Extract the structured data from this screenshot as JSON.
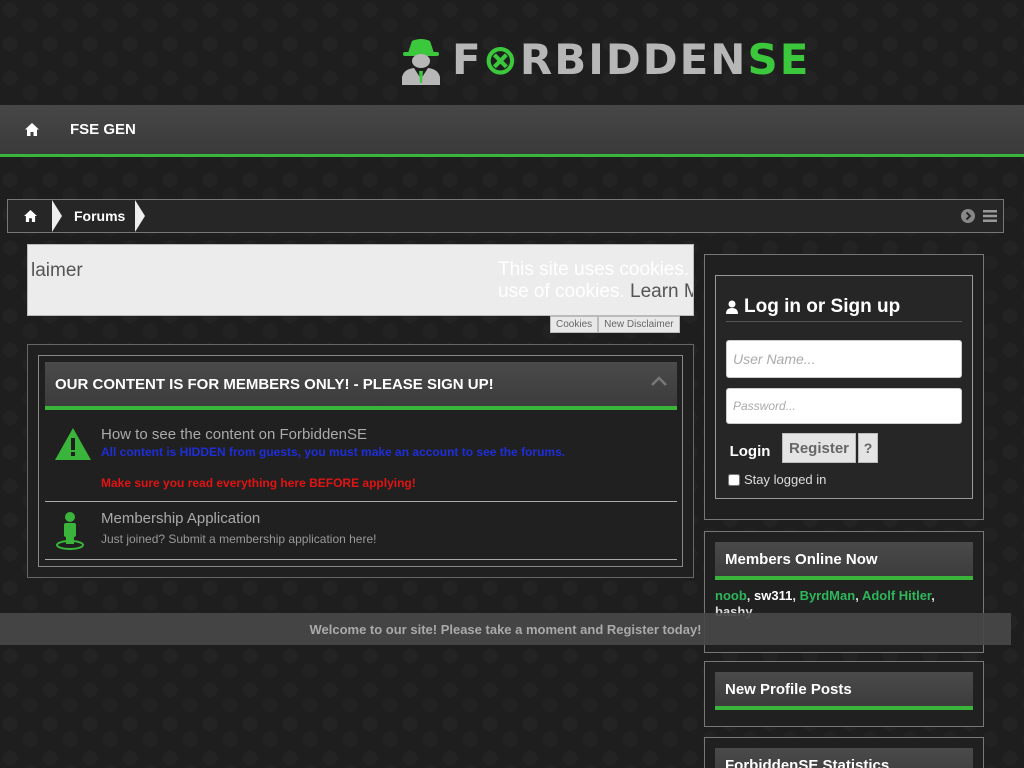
{
  "header": {
    "logo": {
      "part1": "F",
      "part2": "RBIDDEN",
      "part3": "SE"
    },
    "nav": {
      "home_icon": "home-icon",
      "link": "FSE GEN"
    }
  },
  "breadcrumb": {
    "home_icon": "home-icon",
    "item": "Forums",
    "tools": [
      "circle-arrow-right-icon",
      "menu-icon"
    ]
  },
  "cookie": {
    "left_text": "laimer",
    "message_line1": "This site uses cookies. B",
    "message_line2": "use of cookies.",
    "learn_more": "Learn M",
    "tabs": [
      "Cookies",
      "New Disclaimer"
    ]
  },
  "notices": {
    "title": "OUR CONTENT IS FOR MEMBERS ONLY! - PLEASE SIGN UP!",
    "items": [
      {
        "icon": "warning-icon",
        "title": "How to see the content on ForbiddenSE",
        "hidden_text": "All content is HIDDEN from guests, you must make an account to see the forums.",
        "warning_text": "Make sure you read everything here BEFORE applying!"
      },
      {
        "icon": "person-pin-icon",
        "title": "Membership Application",
        "subtitle": "Just joined? Submit a membership application here!"
      }
    ]
  },
  "login": {
    "title": "Log in or Sign up",
    "username_placeholder": "User Name...",
    "password_placeholder": "Password...",
    "login_label": "Login",
    "register_label": "Register",
    "help_label": "?",
    "remember_label": "Stay logged in"
  },
  "members_online": {
    "title": "Members Online Now",
    "members": [
      "noob",
      "sw311",
      "ByrdMan",
      "Adolf Hitler",
      "bashy"
    ],
    "separator": ", "
  },
  "profile_posts": {
    "title": "New Profile Posts"
  },
  "statistics": {
    "title": "ForbiddenSE Statistics"
  },
  "welcome_banner": "Welcome to our site! Please take a moment and Register today!",
  "colors": {
    "accent": "#3ab43a",
    "hidden_text": "#1e2ed8",
    "warning_text": "#e01414",
    "member_green": "#2fb65a"
  }
}
